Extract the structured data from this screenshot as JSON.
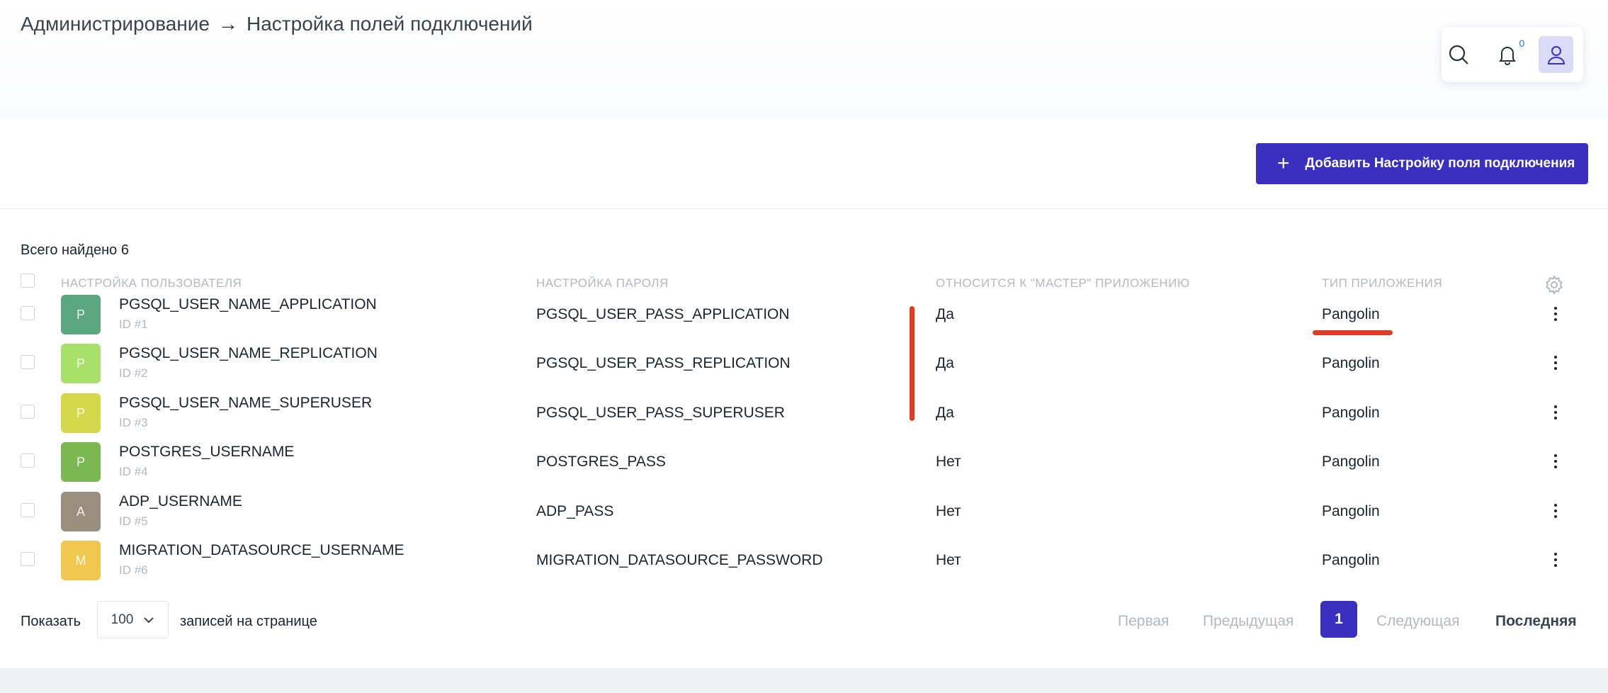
{
  "breadcrumb": {
    "parent": "Администрирование",
    "arrow": "→",
    "current": "Настройка полей подключений"
  },
  "header": {
    "notifications_count": "0"
  },
  "actions": {
    "add_plus": "+",
    "add_label": "Добавить Настройку поля подключения"
  },
  "table": {
    "total_label": "Всего найдено 6",
    "columns": {
      "user": "НАСТРОЙКА ПОЛЬЗОВАТЕЛЯ",
      "password": "НАСТРОЙКА ПАРОЛЯ",
      "master": "ОТНОСИТСЯ К \"МАСТЕР\" ПРИЛОЖЕНИЮ",
      "app_type": "ТИП ПРИЛОЖЕНИЯ"
    },
    "rows": [
      {
        "letter": "P",
        "color": "#5aa780",
        "user": "PGSQL_USER_NAME_APPLICATION",
        "id": "ID #1",
        "password": "PGSQL_USER_PASS_APPLICATION",
        "master": "Да",
        "app_type": "Pangolin"
      },
      {
        "letter": "P",
        "color": "#a8e06a",
        "user": "PGSQL_USER_NAME_REPLICATION",
        "id": "ID #2",
        "password": "PGSQL_USER_PASS_REPLICATION",
        "master": "Да",
        "app_type": "Pangolin"
      },
      {
        "letter": "P",
        "color": "#d3d84a",
        "user": "PGSQL_USER_NAME_SUPERUSER",
        "id": "ID #3",
        "password": "PGSQL_USER_PASS_SUPERUSER",
        "master": "Да",
        "app_type": "Pangolin"
      },
      {
        "letter": "P",
        "color": "#7cb852",
        "user": "POSTGRES_USERNAME",
        "id": "ID #4",
        "password": "POSTGRES_PASS",
        "master": "Нет",
        "app_type": "Pangolin"
      },
      {
        "letter": "A",
        "color": "#9a8f7e",
        "user": "ADP_USERNAME",
        "id": "ID #5",
        "password": "ADP_PASS",
        "master": "Нет",
        "app_type": "Pangolin"
      },
      {
        "letter": "M",
        "color": "#f0c84f",
        "user": "MIGRATION_DATASOURCE_USERNAME",
        "id": "ID #6",
        "password": "MIGRATION_DATASOURCE_PASSWORD",
        "master": "Нет",
        "app_type": "Pangolin"
      }
    ]
  },
  "pagination": {
    "show_label": "Показать",
    "page_size": "100",
    "per_page_label": "записей на странице",
    "first": "Первая",
    "prev": "Предыдущая",
    "current": "1",
    "next": "Следующая",
    "last": "Последняя"
  },
  "annotation_color": "#e33a24",
  "accent_color": "#3a30bf"
}
